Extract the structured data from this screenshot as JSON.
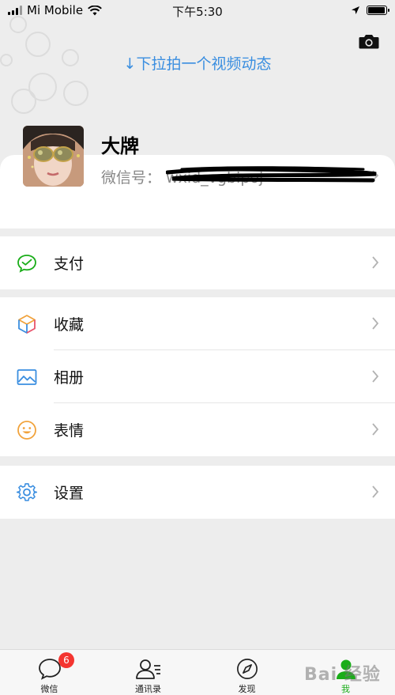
{
  "status_bar": {
    "carrier": "Mi Mobile",
    "time": "下午5:30",
    "battery_level": 0.95
  },
  "header": {
    "pull_hint": "↓下拉拍一个视频动态",
    "camera_icon": "camera-icon"
  },
  "profile": {
    "name": "大牌",
    "wechat_id_label": "微信号：",
    "wechat_id_value": "wxid_vgbipoj"
  },
  "menu": {
    "pay": {
      "label": "支付",
      "icon": "wechat-pay-icon",
      "color": "#1aad19"
    },
    "favorites": {
      "label": "收藏",
      "icon": "cube-icon"
    },
    "album": {
      "label": "相册",
      "icon": "photo-icon",
      "color": "#3a8ee0"
    },
    "stickers": {
      "label": "表情",
      "icon": "smiley-icon",
      "color": "#f1a33c"
    },
    "settings": {
      "label": "设置",
      "icon": "gear-icon",
      "color": "#3a8ee0"
    }
  },
  "tabs": [
    {
      "label": "微信",
      "icon": "chat-bubble-icon",
      "badge": "6"
    },
    {
      "label": "通讯录",
      "icon": "contacts-icon"
    },
    {
      "label": "发现",
      "icon": "compass-icon"
    },
    {
      "label": "我",
      "icon": "me-icon",
      "active": true
    }
  ],
  "watermark": "Bai 经验",
  "colors": {
    "accent_green": "#1aad19",
    "link_blue": "#3a8ee0",
    "badge_red": "#f43530",
    "background": "#ededed"
  }
}
